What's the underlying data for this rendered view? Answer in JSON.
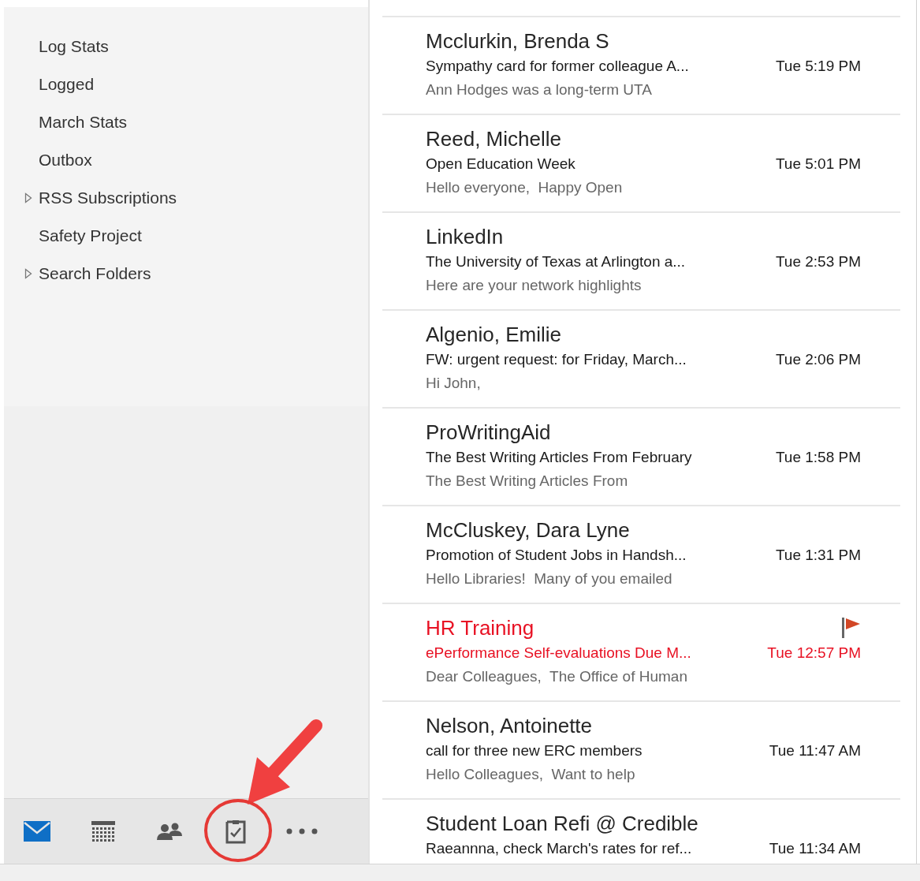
{
  "folders": [
    {
      "label": "Log Stats",
      "expandable": false
    },
    {
      "label": "Logged",
      "expandable": false
    },
    {
      "label": "March Stats",
      "expandable": false
    },
    {
      "label": "Outbox",
      "expandable": false
    },
    {
      "label": "RSS Subscriptions",
      "expandable": true
    },
    {
      "label": "Safety Project",
      "expandable": false
    },
    {
      "label": "Search Folders",
      "expandable": true
    }
  ],
  "nav": [
    {
      "kind": "mail",
      "selected": true
    },
    {
      "kind": "calendar",
      "selected": false
    },
    {
      "kind": "people",
      "selected": false
    },
    {
      "kind": "tasks",
      "selected": false
    },
    {
      "kind": "more",
      "selected": false
    }
  ],
  "messages": [
    {
      "sender": "Mcclurkin, Brenda S",
      "subject": "Sympathy card for former colleague A...",
      "time": "Tue 5:19 PM",
      "preview": "Ann Hodges was a long-term UTA",
      "flagged": false
    },
    {
      "sender": "Reed, Michelle",
      "subject": "Open Education Week",
      "time": "Tue 5:01 PM",
      "preview": "Hello everyone,  Happy Open",
      "flagged": false
    },
    {
      "sender": "LinkedIn",
      "subject": "The University of Texas at Arlington a...",
      "time": "Tue 2:53 PM",
      "preview": "Here are your network highlights",
      "flagged": false
    },
    {
      "sender": "Algenio, Emilie",
      "subject": "FW: urgent request: for Friday, March...",
      "time": "Tue 2:06 PM",
      "preview": "Hi John,",
      "flagged": false
    },
    {
      "sender": "ProWritingAid",
      "subject": "The Best Writing Articles From February",
      "time": "Tue 1:58 PM",
      "preview": "The Best Writing Articles From",
      "flagged": false
    },
    {
      "sender": "McCluskey, Dara Lyne",
      "subject": "Promotion of Student Jobs in Handsh...",
      "time": "Tue 1:31 PM",
      "preview": "Hello Libraries!  Many of you emailed",
      "flagged": false
    },
    {
      "sender": "HR Training",
      "subject": "ePerformance Self-evaluations Due M...",
      "time": "Tue 12:57 PM",
      "preview": "Dear Colleagues,  The Office of Human",
      "flagged": true
    },
    {
      "sender": "Nelson, Antoinette",
      "subject": "call for three new ERC members",
      "time": "Tue 11:47 AM",
      "preview": "Hello Colleagues,  Want to help",
      "flagged": false
    },
    {
      "sender": "Student Loan Refi @ Credible",
      "subject": "Raeannna, check March's rates for ref...",
      "time": "Tue 11:34 AM",
      "flagged": false
    }
  ]
}
